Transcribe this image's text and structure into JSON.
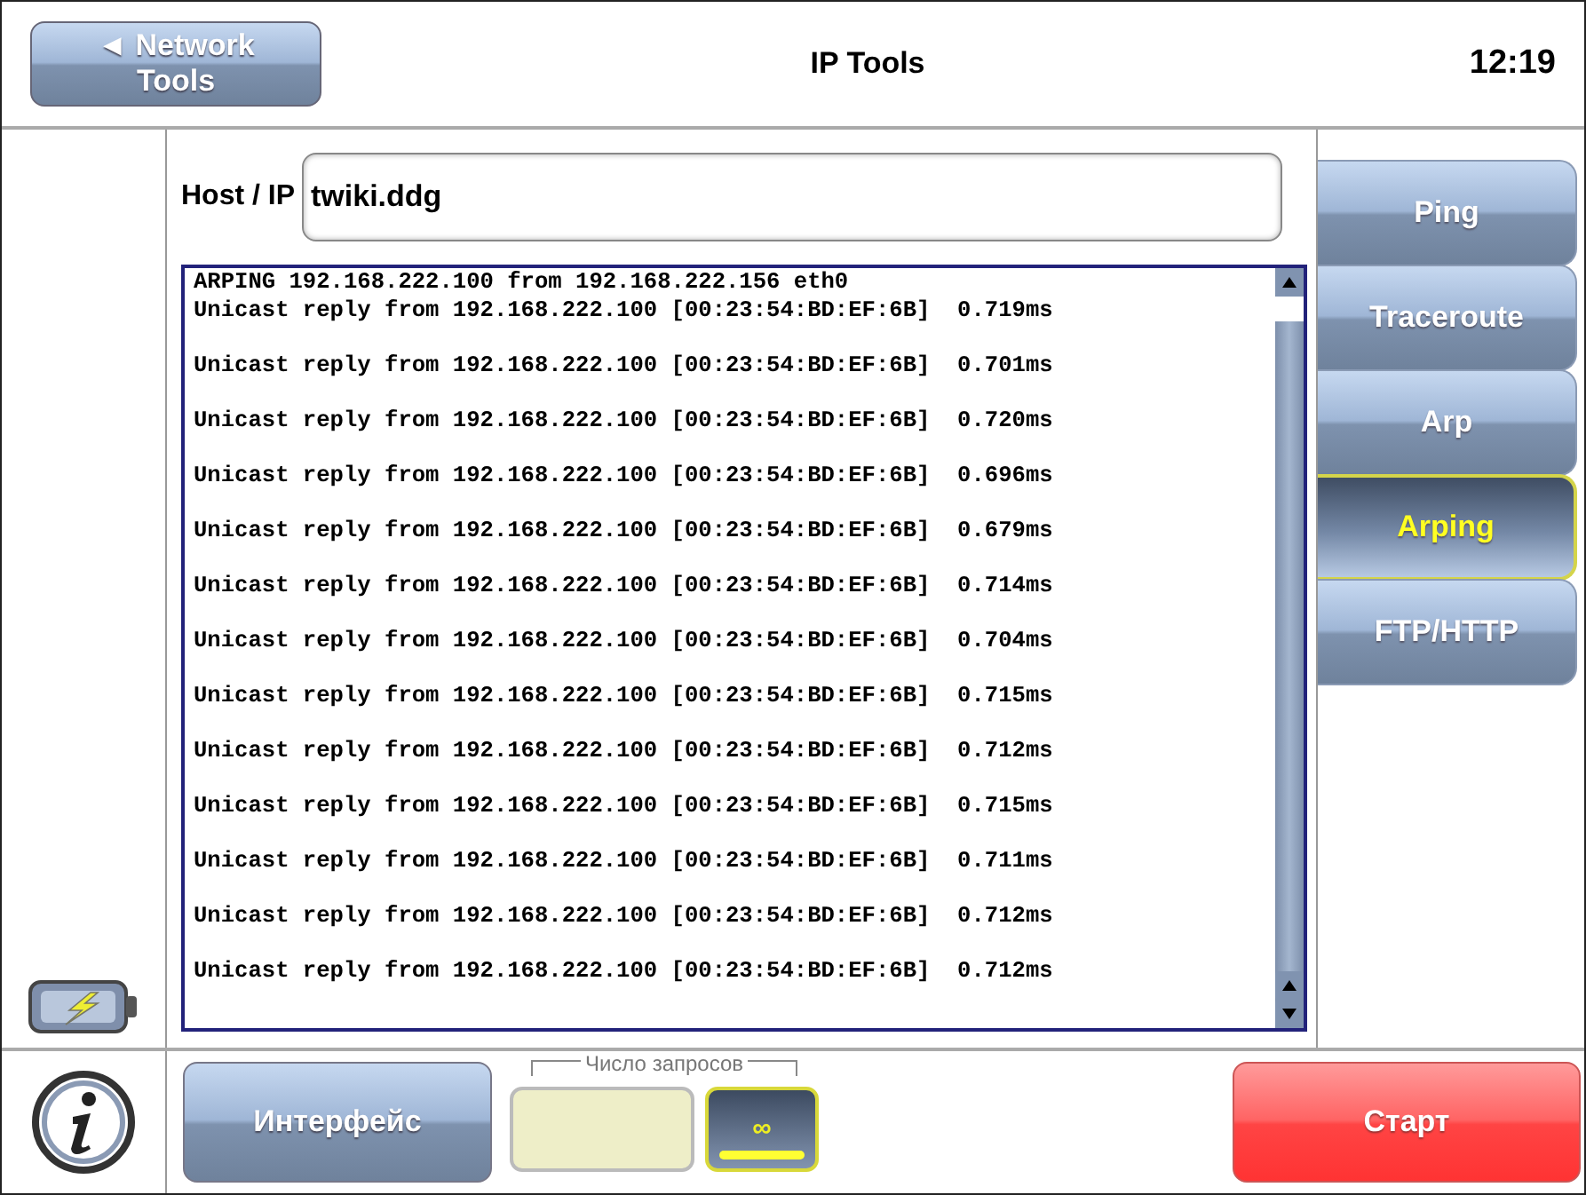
{
  "header": {
    "back_button": {
      "arrow": "◄",
      "label": "Network Tools"
    },
    "title": "IP Tools",
    "clock": "12:19"
  },
  "host": {
    "label": "Host / IP",
    "value": "twiki.ddg"
  },
  "log": {
    "header_line": "ARPING 192.168.222.100 from 192.168.222.156 eth0",
    "replies": [
      "Unicast reply from 192.168.222.100 [00:23:54:BD:EF:6B]  0.719ms",
      "Unicast reply from 192.168.222.100 [00:23:54:BD:EF:6B]  0.701ms",
      "Unicast reply from 192.168.222.100 [00:23:54:BD:EF:6B]  0.720ms",
      "Unicast reply from 192.168.222.100 [00:23:54:BD:EF:6B]  0.696ms",
      "Unicast reply from 192.168.222.100 [00:23:54:BD:EF:6B]  0.679ms",
      "Unicast reply from 192.168.222.100 [00:23:54:BD:EF:6B]  0.714ms",
      "Unicast reply from 192.168.222.100 [00:23:54:BD:EF:6B]  0.704ms",
      "Unicast reply from 192.168.222.100 [00:23:54:BD:EF:6B]  0.715ms",
      "Unicast reply from 192.168.222.100 [00:23:54:BD:EF:6B]  0.712ms",
      "Unicast reply from 192.168.222.100 [00:23:54:BD:EF:6B]  0.715ms",
      "Unicast reply from 192.168.222.100 [00:23:54:BD:EF:6B]  0.711ms",
      "Unicast reply from 192.168.222.100 [00:23:54:BD:EF:6B]  0.712ms",
      "Unicast reply from 192.168.222.100 [00:23:54:BD:EF:6B]  0.712ms"
    ]
  },
  "tabs": [
    {
      "label": "Ping",
      "selected": false
    },
    {
      "label": "Traceroute",
      "selected": false
    },
    {
      "label": "Arp",
      "selected": false
    },
    {
      "label": "Arping",
      "selected": true
    },
    {
      "label": "FTP/HTTP",
      "selected": false
    }
  ],
  "bottom": {
    "interface_button": "Интерфейс",
    "request_count": {
      "label": "Число запросов",
      "options": [
        {
          "selected": false
        },
        {
          "label": "∞",
          "selected": true
        }
      ]
    },
    "start_button": "Старт"
  }
}
